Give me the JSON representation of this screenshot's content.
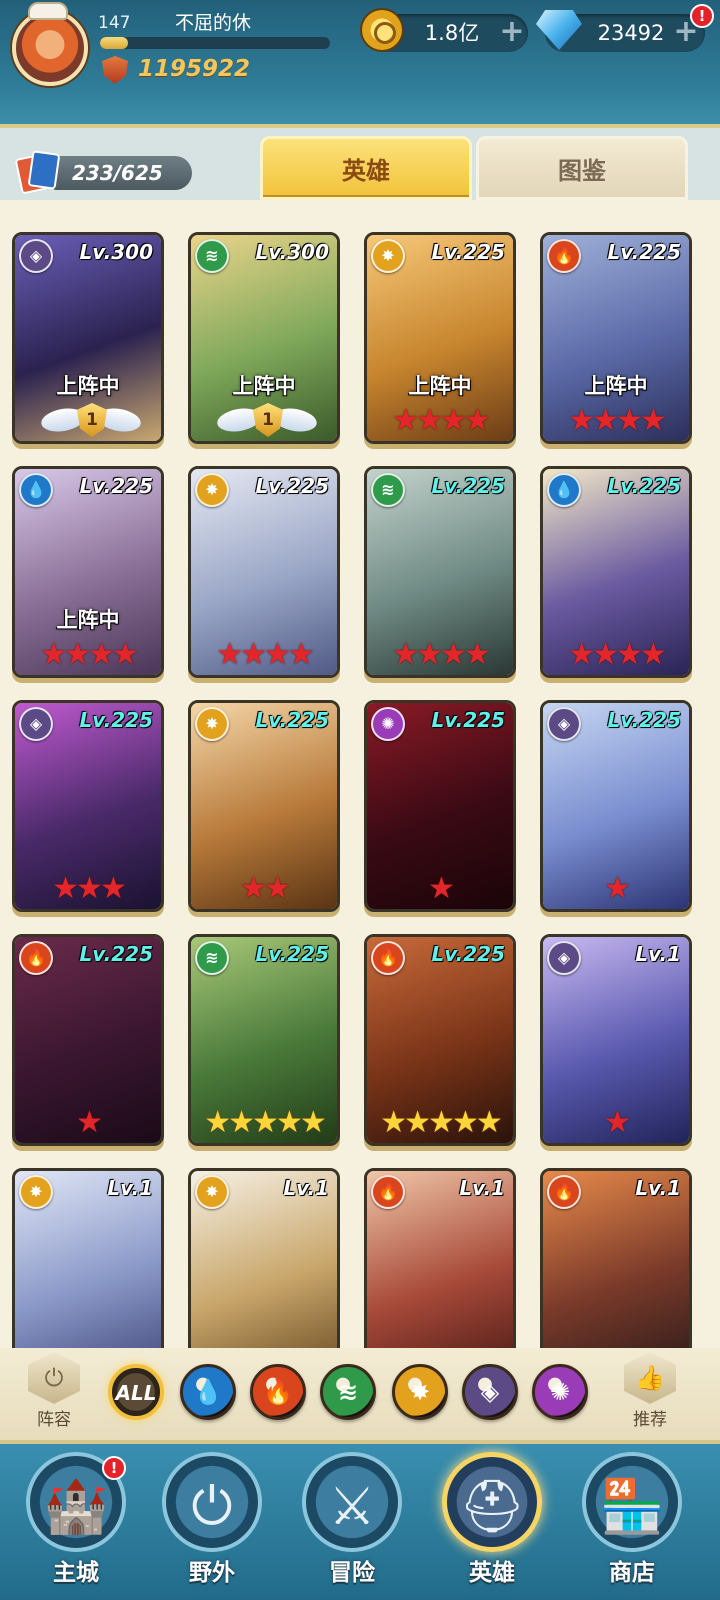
{
  "player": {
    "level": "147",
    "name": "不屈的休",
    "exp_fraction": 0.12,
    "power": "1195922"
  },
  "currency": {
    "gold": "1.8亿",
    "gems": "23492",
    "plus": "+",
    "alert": "!"
  },
  "collection": {
    "count": "233/625"
  },
  "tabs": {
    "heroes": "英雄",
    "codex": "图鉴"
  },
  "heroes": [
    {
      "element": "shadow",
      "level": "Lv.300",
      "deployed": "上阵中",
      "tier": "1",
      "stars": 0
    },
    {
      "element": "nature",
      "level": "Lv.300",
      "deployed": "上阵中",
      "tier": "1",
      "stars": 0
    },
    {
      "element": "light",
      "level": "Lv.225",
      "deployed": "上阵中",
      "stars": 4,
      "star_color": "red"
    },
    {
      "element": "fire",
      "level": "Lv.225",
      "deployed": "上阵中",
      "stars": 4,
      "star_color": "red"
    },
    {
      "element": "water",
      "level": "Lv.225",
      "deployed": "上阵中",
      "stars": 4,
      "star_color": "red"
    },
    {
      "element": "light",
      "level": "Lv.225",
      "stars": 4,
      "star_color": "red"
    },
    {
      "element": "nature",
      "level": "Lv.225",
      "stars": 4,
      "star_color": "red"
    },
    {
      "element": "water",
      "level": "Lv.225",
      "stars": 4,
      "star_color": "red"
    },
    {
      "element": "shadow",
      "level": "Lv.225",
      "stars": 3,
      "star_color": "red"
    },
    {
      "element": "light",
      "level": "Lv.225",
      "stars": 2,
      "star_color": "red"
    },
    {
      "element": "arcane",
      "level": "Lv.225",
      "stars": 1,
      "star_color": "red"
    },
    {
      "element": "shadow",
      "level": "Lv.225",
      "stars": 1,
      "star_color": "red"
    },
    {
      "element": "fire",
      "level": "Lv.225",
      "stars": 1,
      "star_color": "red"
    },
    {
      "element": "nature",
      "level": "Lv.225",
      "stars": 5,
      "star_color": "gold"
    },
    {
      "element": "fire",
      "level": "Lv.225",
      "stars": 5,
      "star_color": "gold"
    },
    {
      "element": "shadow",
      "level": "Lv.1",
      "stars": 1,
      "star_color": "red"
    },
    {
      "element": "light",
      "level": "Lv.1",
      "stars": 0
    },
    {
      "element": "light",
      "level": "Lv.1",
      "stars": 0
    },
    {
      "element": "fire",
      "level": "Lv.1",
      "stars": 0
    },
    {
      "element": "fire",
      "level": "Lv.1",
      "stars": 0
    }
  ],
  "filter": {
    "lineup_label": "阵容",
    "recommend_label": "推荐",
    "all_label": "ALL",
    "elements": [
      "water",
      "fire",
      "nature",
      "light",
      "shadow",
      "arcane"
    ]
  },
  "nav": [
    {
      "label": "主城",
      "icon": "castle-icon",
      "alert": "!"
    },
    {
      "label": "野外",
      "icon": "portal-icon"
    },
    {
      "label": "冒险",
      "icon": "sword-icon"
    },
    {
      "label": "英雄",
      "icon": "helmet-icon",
      "active": true
    },
    {
      "label": "商店",
      "icon": "shop-icon"
    }
  ],
  "colors": {
    "fire": "#d9461e",
    "water": "#1f78c8",
    "nature": "#2f9a4a",
    "light": "#e2a21e",
    "shadow": "#5b4a86",
    "arcane": "#9a3bb8",
    "accent": "#f2c33a"
  }
}
